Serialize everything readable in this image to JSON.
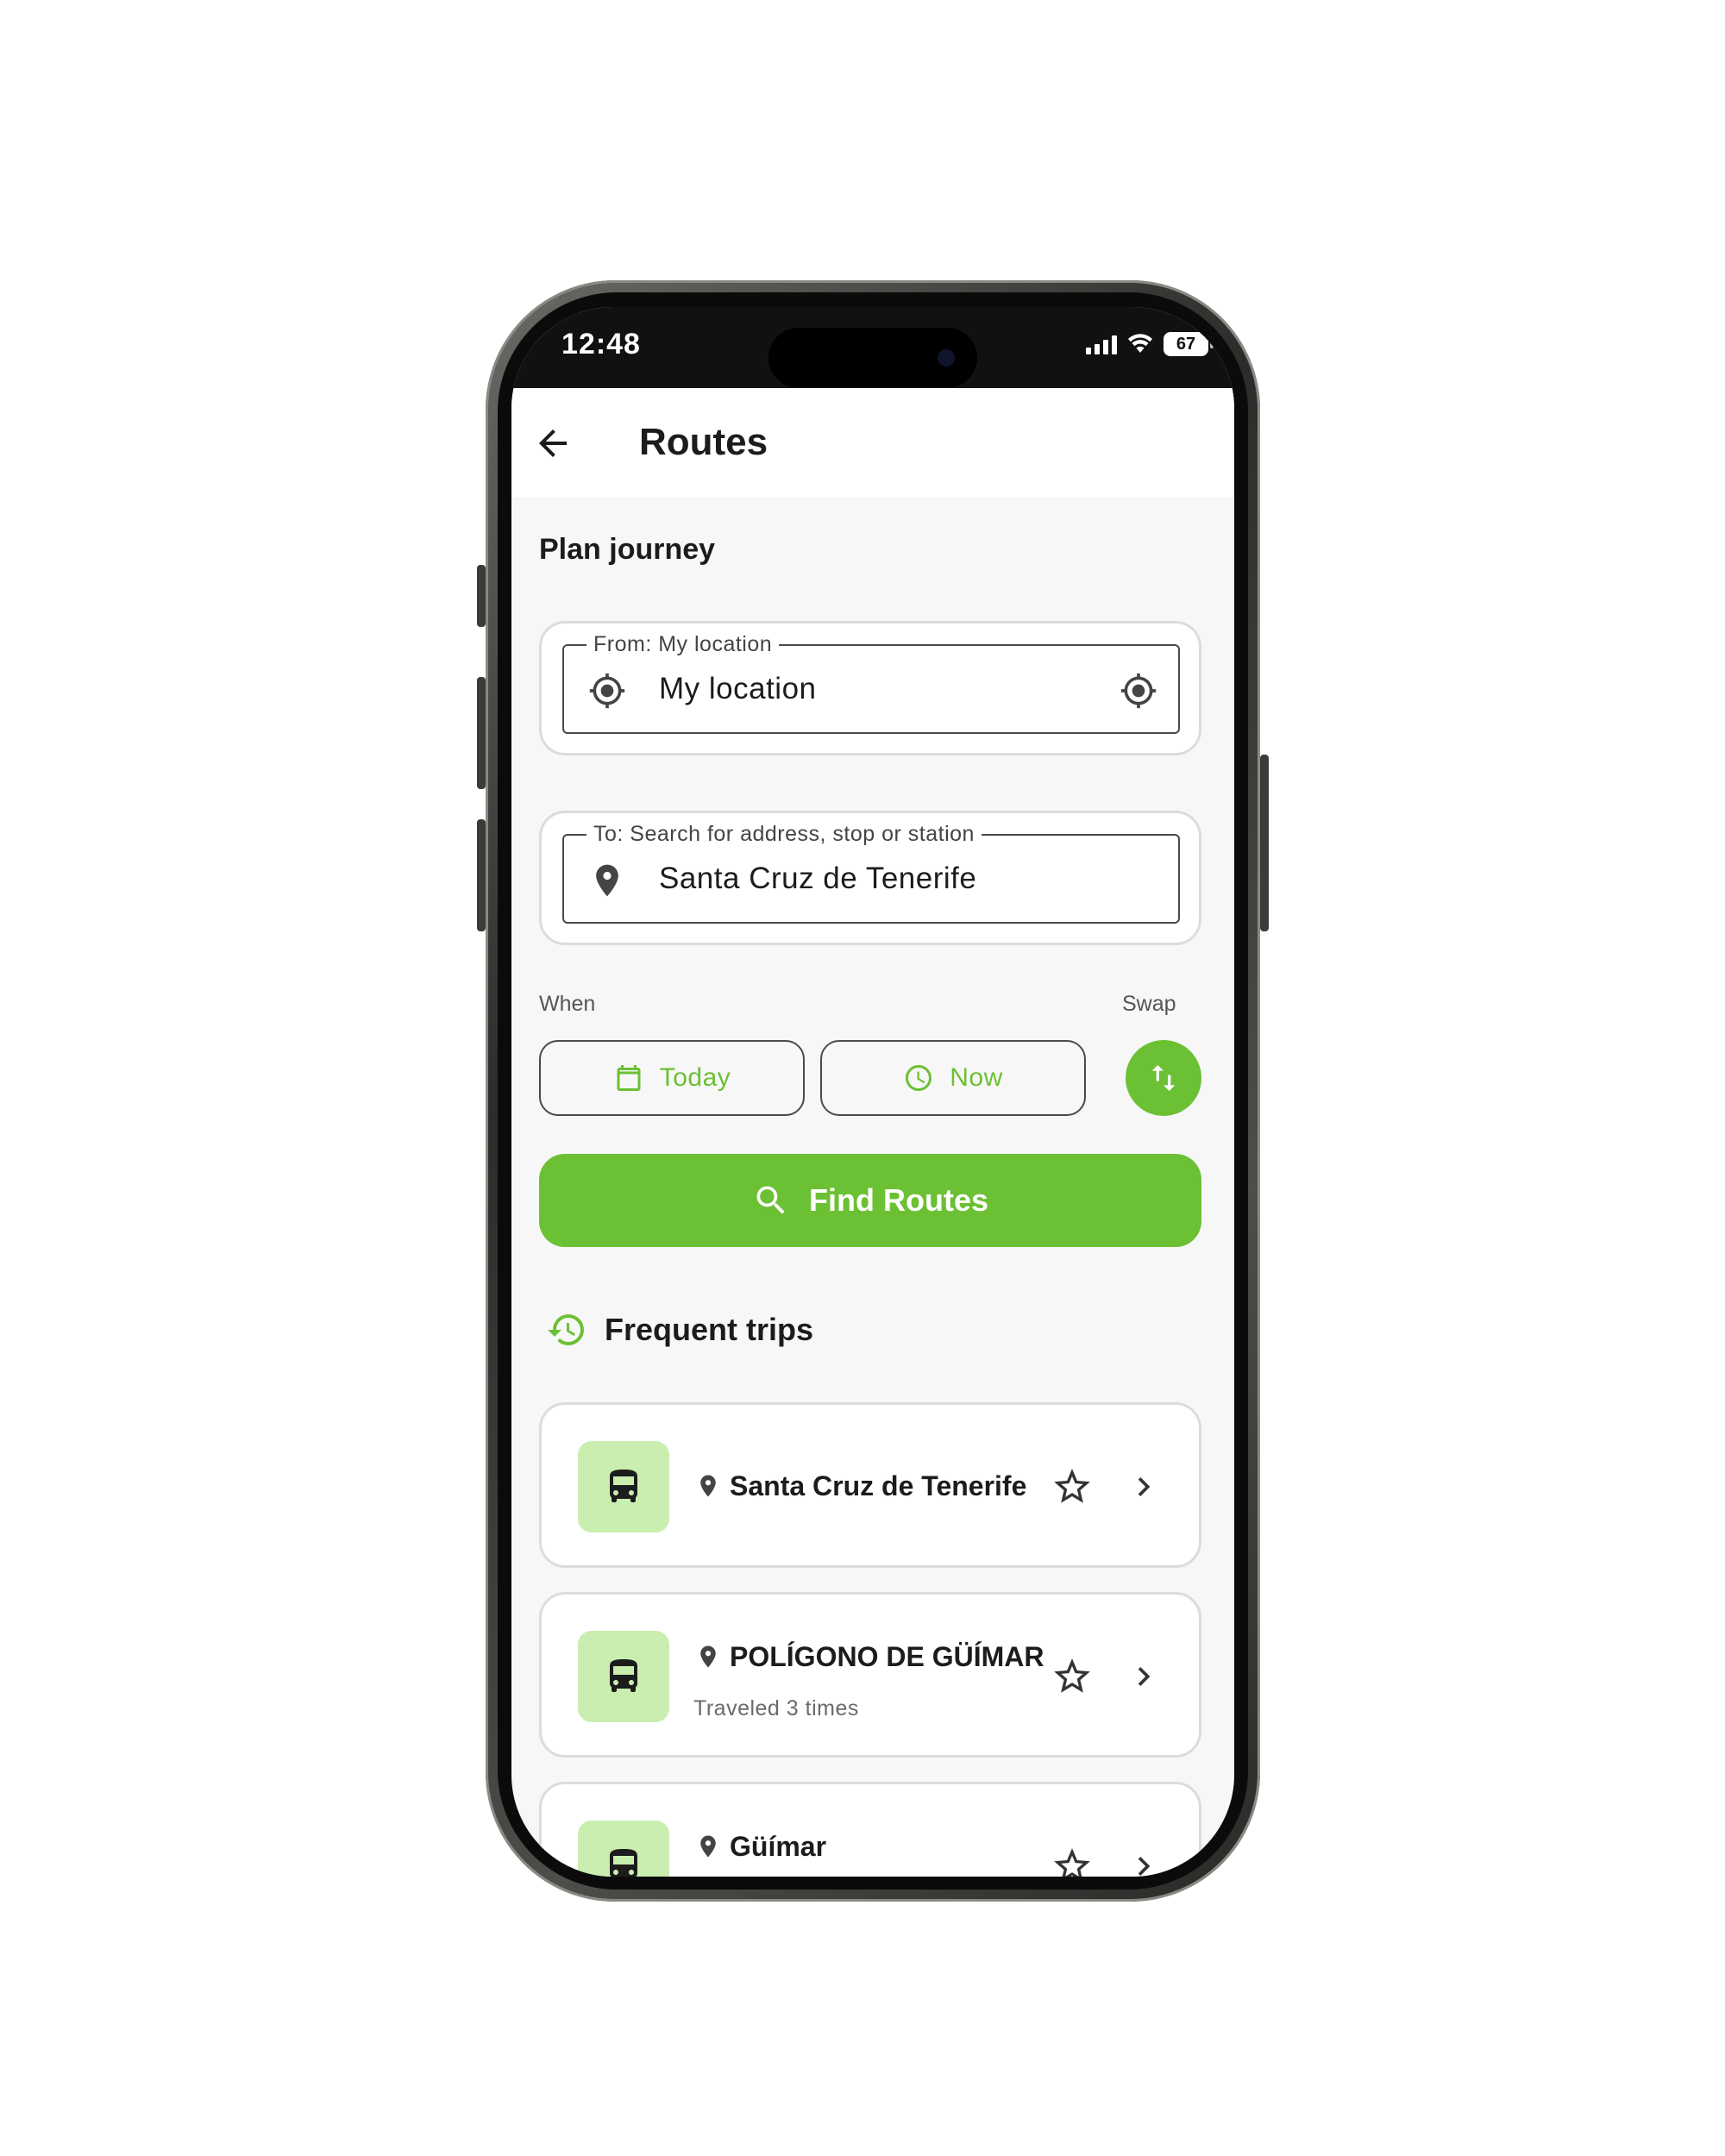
{
  "status_bar": {
    "time": "12:48",
    "battery": "67"
  },
  "app_bar": {
    "title": "Routes",
    "back_icon": "arrow-back-icon"
  },
  "plan": {
    "title": "Plan journey",
    "from": {
      "label": "From: My location",
      "value": "My location",
      "icon": "my-location-icon"
    },
    "to": {
      "label": "To: Search for address, stop or station",
      "value": "Santa Cruz de Tenerife",
      "icon": "map-pin-icon"
    },
    "when_label": "When",
    "swap_label": "Swap",
    "date_button": "Today",
    "time_button": "Now",
    "find_button": "Find Routes"
  },
  "frequent": {
    "title": "Frequent trips",
    "trips": [
      {
        "name": "Santa Cruz de Tenerife",
        "subtitle": ""
      },
      {
        "name": "POLÍGONO DE GÜÍMAR",
        "subtitle": "Traveled 3 times"
      },
      {
        "name": "Güímar",
        "subtitle": ""
      }
    ]
  },
  "colors": {
    "accent": "#6cc033",
    "accent_light": "#c9eeb0",
    "background": "#f7f7f7",
    "text": "#1c1c1c"
  }
}
